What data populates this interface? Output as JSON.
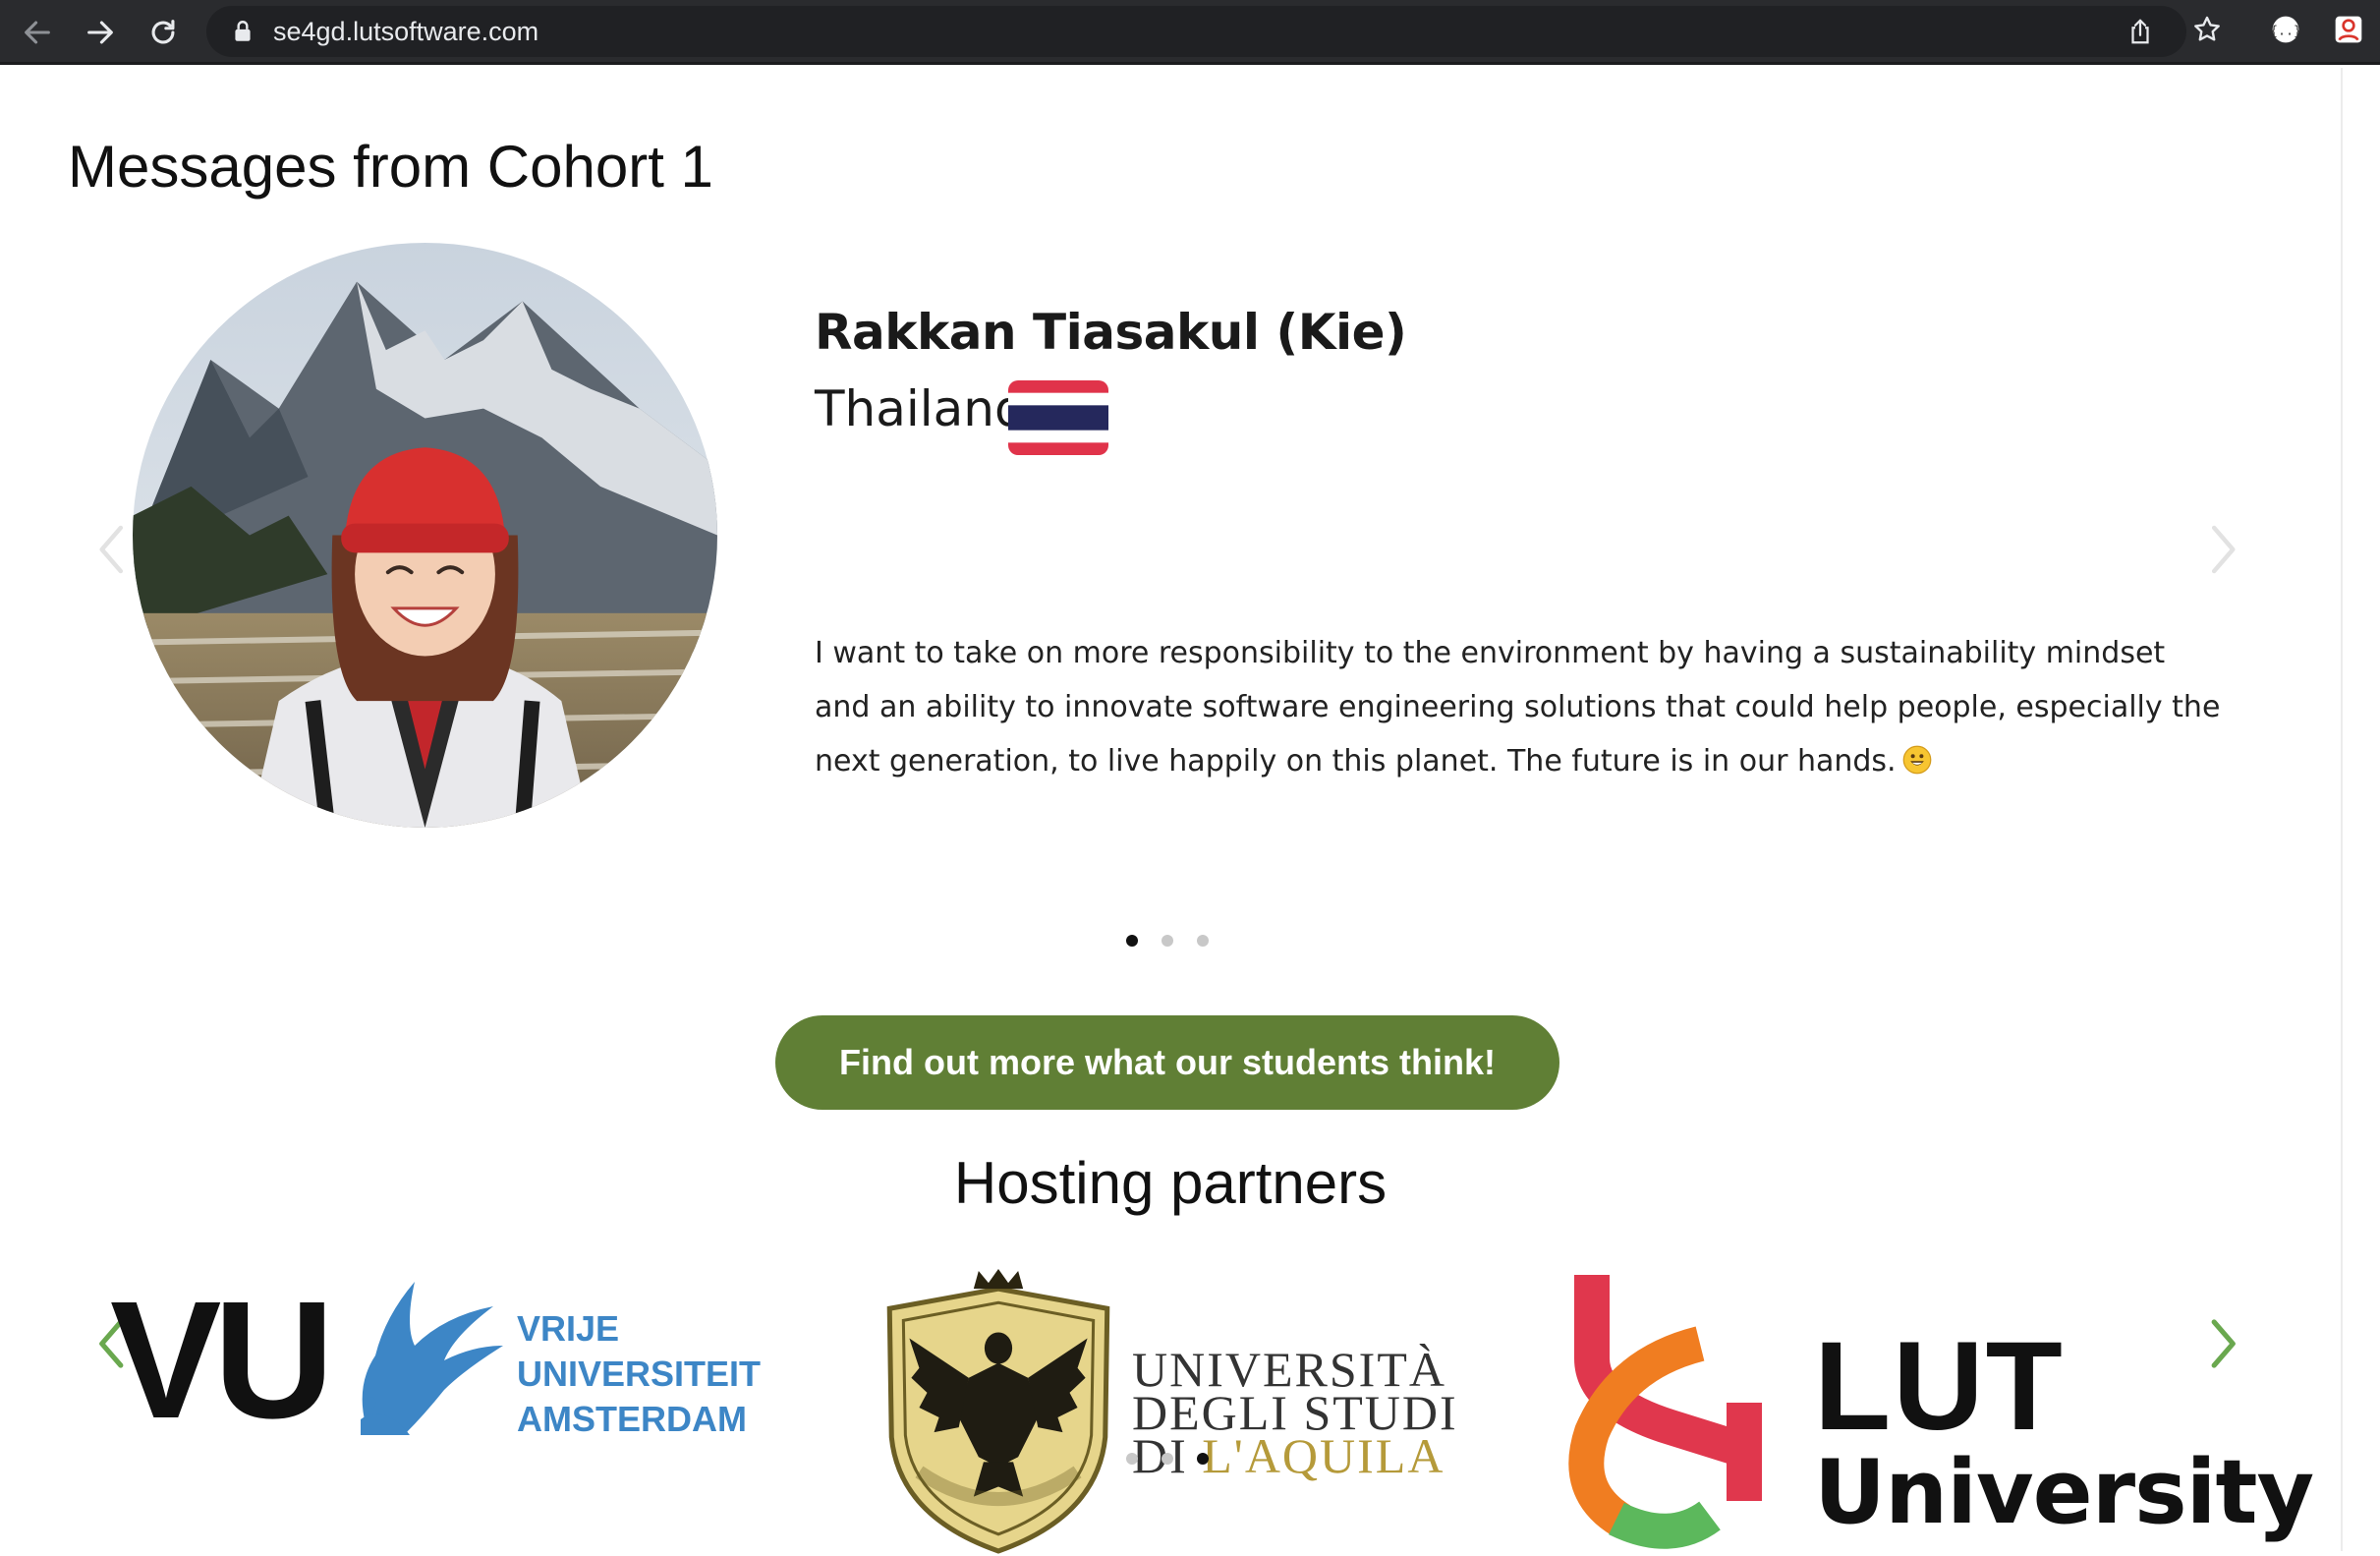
{
  "browser": {
    "url": "se4gd.lutsoftware.com",
    "icons": [
      "back-arrow-icon",
      "forward-arrow-icon",
      "reload-icon",
      "lock-icon",
      "share-icon",
      "star-icon",
      "extension-icon",
      "profile-icon"
    ]
  },
  "testimonials": {
    "title": "Messages from Cohort 1",
    "student": {
      "name": "Rakkan Tiasakul (Kie)",
      "country": "Thailand",
      "quote": "I want to take on more responsibility to the environment by having a sustainability mindset and an ability to innovate software engineering solutions that could help people, especially the next generation, to live happily on this planet. The future is in our hands."
    },
    "slides": 3,
    "active_slide": 0
  },
  "cta": {
    "label": "Find out more what our students think!",
    "color": "#607f35"
  },
  "partners": {
    "title": "Hosting partners",
    "slides": 3,
    "active_slide": 2,
    "vu": {
      "letters": "VU",
      "line1": "VRIJE",
      "line2": "UNIVERSITEIT",
      "line3": "AMSTERDAM"
    },
    "aquila": {
      "line1": "UNIVERSITÀ",
      "line2": "DEGLI STUDI",
      "line3_a": "DI ",
      "line3_b": "L'AQUILA"
    },
    "lut": {
      "line1": "LUT",
      "line2": "University"
    }
  },
  "colors": {
    "accent_green": "#607f35",
    "arrow_green": "#6aa84f",
    "vu_blue": "#3d86c6",
    "lut_red": "#e0374d",
    "lut_orange": "#f07d21",
    "lut_green": "#5cb85c"
  }
}
